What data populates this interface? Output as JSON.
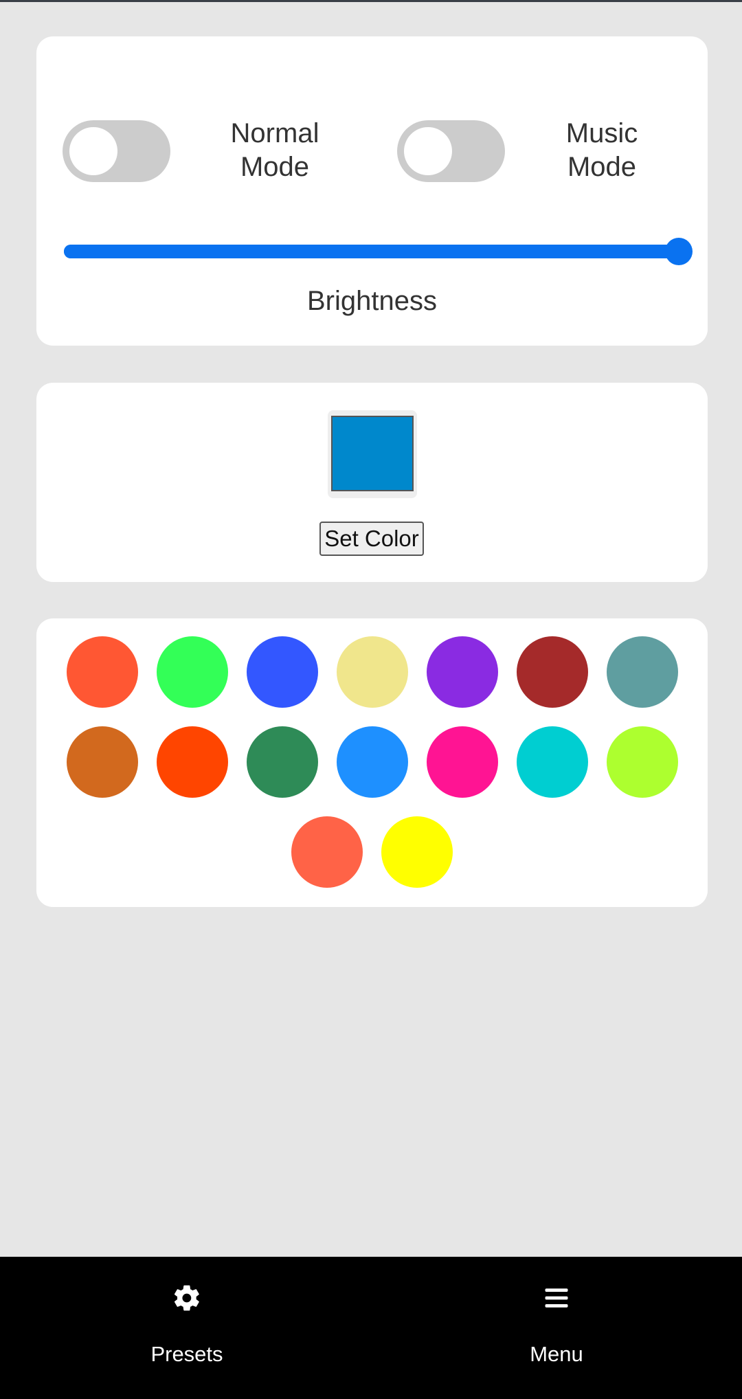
{
  "controls": {
    "normal_mode": {
      "label": "Normal Mode",
      "enabled": false
    },
    "music_mode": {
      "label": "Music Mode",
      "enabled": false
    },
    "brightness": {
      "label": "Brightness",
      "value_percent": 100
    },
    "accent_color": "#0a72f0"
  },
  "color_picker": {
    "current_color": "#0088cc",
    "set_button_label": "Set Color"
  },
  "presets": {
    "colors": [
      "#ff5733",
      "#33ff57",
      "#3357ff",
      "#f0e68c",
      "#8a2be2",
      "#a52a2a",
      "#5f9ea0",
      "#d2691e",
      "#ff4500",
      "#2e8b57",
      "#1e90ff",
      "#ff1493",
      "#00ced1",
      "#adff2f",
      "#ff6347",
      "#ffff00"
    ]
  },
  "bottom_nav": {
    "presets": {
      "label": "Presets",
      "icon": "gear-icon"
    },
    "menu": {
      "label": "Menu",
      "icon": "hamburger-menu-icon"
    }
  }
}
